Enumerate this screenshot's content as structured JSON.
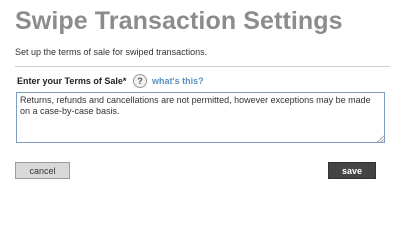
{
  "header": {
    "title": "Swipe Transaction Settings",
    "subtitle": "Set up the terms of sale for swiped transactions."
  },
  "form": {
    "terms_label": "Enter your Terms of Sale*",
    "help_icon": "question-mark-icon",
    "help_glyph": "?",
    "help_link": "what's this?",
    "terms_value": "Returns, refunds and cancellations are not permitted, however exceptions may be made on a case-by-case basis."
  },
  "actions": {
    "cancel_label": "cancel",
    "save_label": "save"
  },
  "colors": {
    "title": "#8c8c8c",
    "link": "#5a8fc2",
    "save_button": "#444444",
    "cancel_button": "#d9d9d9"
  }
}
